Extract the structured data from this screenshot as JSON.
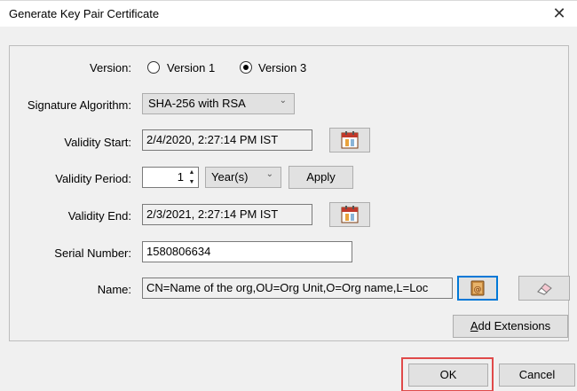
{
  "dialog": {
    "title": "Generate Key Pair Certificate",
    "close_glyph": "✕"
  },
  "version": {
    "label": "Version:",
    "option1": "Version 1",
    "option2": "Version 3",
    "selected": "Version 3"
  },
  "signature": {
    "label": "Signature Algorithm:",
    "value": "SHA-256 with RSA"
  },
  "validity_start": {
    "label": "Validity Start:",
    "value": "2/4/2020, 2:27:14 PM IST"
  },
  "validity_period": {
    "label": "Validity Period:",
    "amount": "1",
    "unit": "Year(s)",
    "apply_label": "Apply"
  },
  "validity_end": {
    "label": "Validity End:",
    "value": "2/3/2021, 2:27:14 PM IST"
  },
  "serial": {
    "label": "Serial Number:",
    "value": "1580806634"
  },
  "name": {
    "label": "Name:",
    "value": "CN=Name of the org,OU=Org Unit,O=Org name,L=Loc"
  },
  "extensions": {
    "label_prefix": "A",
    "label_rest": "dd Extensions"
  },
  "footer": {
    "ok_label": "OK",
    "cancel_label": "Cancel"
  },
  "colors": {
    "highlight": "#e04a4a",
    "focus": "#0078d7"
  },
  "icons": [
    "calendar-icon",
    "address-book-icon",
    "eraser-icon",
    "close-icon",
    "chevron-down-icon"
  ]
}
